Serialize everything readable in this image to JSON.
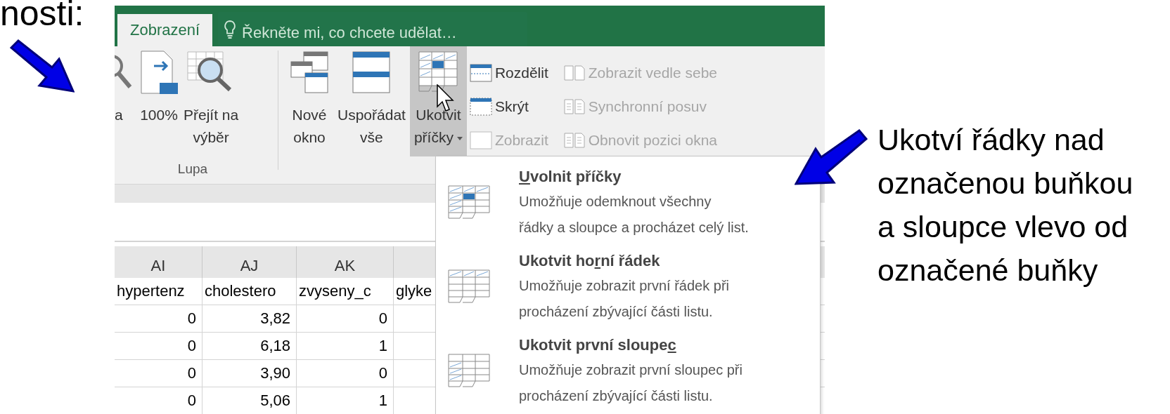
{
  "slide_text": "nosti:",
  "tabs": [
    {
      "label": "Zobrazení",
      "selected": true
    }
  ],
  "tell_me": {
    "placeholder": "Řekněte mi, co chcete udělat…"
  },
  "ribbon": {
    "groups": [
      {
        "label": "Lupa",
        "large_buttons": [
          {
            "lines": [
              "a"
            ]
          },
          {
            "lines": [
              "100%"
            ]
          },
          {
            "lines": [
              "Přejít na",
              "výběr"
            ]
          }
        ]
      },
      {
        "large_buttons": [
          {
            "lines": [
              "Nové",
              "okno"
            ]
          },
          {
            "lines": [
              "Uspořádat",
              "vše"
            ]
          },
          {
            "lines": [
              "Ukotvit",
              "příčky"
            ],
            "dropdown": true,
            "expanded": true
          }
        ],
        "small_columns": [
          [
            {
              "label": "Rozdělit",
              "disabled": false
            },
            {
              "label": "Skrýt",
              "disabled": false
            },
            {
              "label": "Zobrazit",
              "disabled": true
            }
          ],
          [
            {
              "label": "Zobrazit vedle sebe",
              "disabled": true
            },
            {
              "label": "Synchronní posuv",
              "disabled": true
            },
            {
              "label": "Obnovit pozici okna",
              "disabled": true
            }
          ]
        ]
      }
    ]
  },
  "sheet": {
    "columns": [
      "AI",
      "AJ",
      "AK"
    ],
    "rows": [
      {
        "kind": "text",
        "cells": [
          "hypertenz",
          "cholestero",
          "zvyseny_c",
          "glyke"
        ]
      },
      {
        "kind": "number",
        "cells": [
          "0",
          "3,82",
          "0"
        ]
      },
      {
        "kind": "number",
        "cells": [
          "0",
          "6,18",
          "1"
        ]
      },
      {
        "kind": "number",
        "cells": [
          "0",
          "3,90",
          "0"
        ]
      },
      {
        "kind": "number",
        "cells": [
          "0",
          "5,06",
          "1"
        ]
      }
    ]
  },
  "menu": [
    {
      "title": [
        {
          "text": "U",
          "underline": true
        },
        {
          "text": "volnit příčky",
          "underline": false
        }
      ],
      "description": [
        "Umožňuje odemknout všechny",
        "řádky a sloupce a procházet celý list."
      ]
    },
    {
      "title": [
        {
          "text": "Ukotvit ho",
          "underline": false
        },
        {
          "text": "r",
          "underline": true
        },
        {
          "text": "ní řádek",
          "underline": false
        }
      ],
      "description": [
        "Umožňuje zobrazit první řádek při",
        "procházení zbývající části listu."
      ]
    },
    {
      "title": [
        {
          "text": "Ukotvit první sloupe",
          "underline": false
        },
        {
          "text": "c",
          "underline": true
        }
      ],
      "description": [
        "Umožňuje zobrazit první sloupec při",
        "procházení zbývající části listu."
      ]
    }
  ],
  "annotation": [
    "Ukotví řádky nad",
    "označenou buňkou",
    "a sloupce vlevo od",
    "označené buňky"
  ]
}
